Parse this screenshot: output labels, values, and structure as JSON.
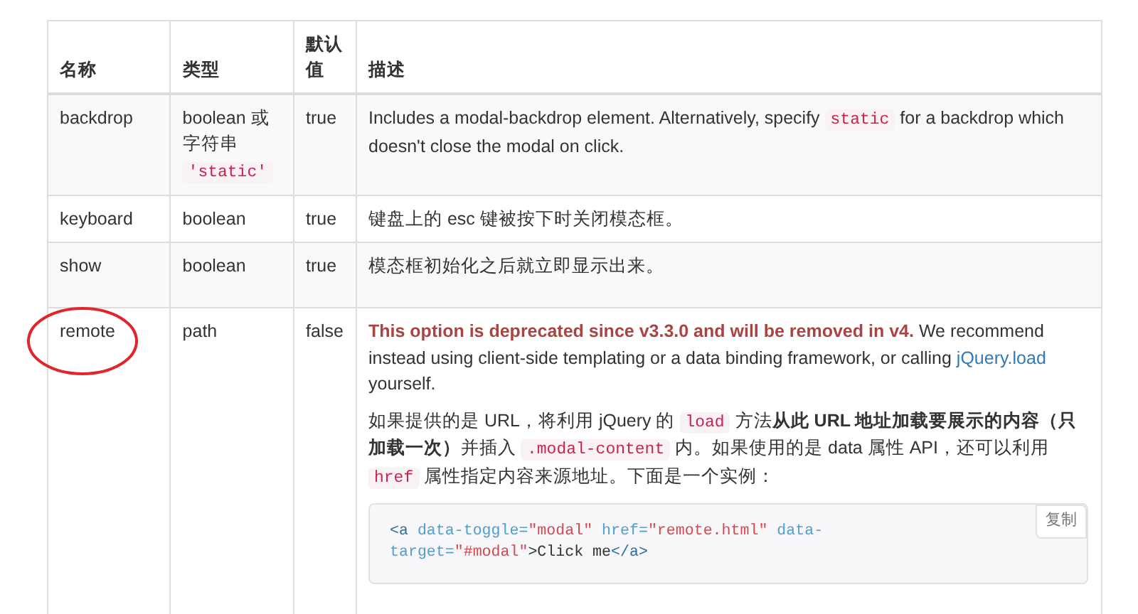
{
  "table": {
    "columns": [
      "名称",
      "类型",
      "默认值",
      "描述"
    ],
    "rows": [
      {
        "name": "backdrop",
        "circled": false,
        "type": [
          {
            "kind": "line",
            "text": "boolean 或"
          },
          {
            "kind": "line",
            "text": "字符串"
          },
          {
            "kind": "code",
            "text": "'static'"
          }
        ],
        "default": "true",
        "description": [
          [
            {
              "kind": "text",
              "text": "Includes a modal-backdrop element. Alternatively, specify "
            },
            {
              "kind": "code",
              "text": "static"
            },
            {
              "kind": "text",
              "text": " for a backdrop which doesn't close the modal on click."
            }
          ]
        ]
      },
      {
        "name": "keyboard",
        "circled": false,
        "type": [
          {
            "kind": "text",
            "text": "boolean"
          }
        ],
        "default": "true",
        "description": [
          [
            {
              "kind": "text",
              "text": "键盘上的 esc 键被按下时关闭模态框。"
            }
          ]
        ]
      },
      {
        "name": "show",
        "circled": false,
        "type": [
          {
            "kind": "text",
            "text": "boolean"
          }
        ],
        "default": "true",
        "description": [
          [
            {
              "kind": "text",
              "text": "模态框初始化之后就立即显示出来。"
            }
          ]
        ]
      },
      {
        "name": "remote",
        "circled": true,
        "type": [
          {
            "kind": "text",
            "text": "path"
          }
        ],
        "default": "false",
        "description": [
          [
            {
              "kind": "warning",
              "text": "This option is deprecated since v3.3.0 and will be removed in v4."
            },
            {
              "kind": "text",
              "text": " We recommend instead using client-side templating or a data binding framework, or calling "
            },
            {
              "kind": "link",
              "text": "jQuery.load"
            },
            {
              "kind": "text",
              "text": " yourself."
            }
          ],
          [
            {
              "kind": "text",
              "text": "如果提供的是 URL，将利用 jQuery 的 "
            },
            {
              "kind": "code",
              "text": "load"
            },
            {
              "kind": "text",
              "text": " 方法"
            },
            {
              "kind": "strong",
              "text": "从此 URL 地址加载要展示的内容（只加载一次）"
            },
            {
              "kind": "text",
              "text": "并插入 "
            },
            {
              "kind": "code",
              "text": ".modal-content"
            },
            {
              "kind": "text",
              "text": " 内。如果使用的是 data 属性 API，还可以利用 "
            },
            {
              "kind": "code",
              "text": "href"
            },
            {
              "kind": "text",
              "text": " 属性指定内容来源地址。下面是一个实例："
            }
          ]
        ],
        "code_example": {
          "copy_button": "复制",
          "tokens": [
            {
              "kind": "tag",
              "text": "<a"
            },
            {
              "kind": "attr",
              "text": " data-toggle="
            },
            {
              "kind": "value",
              "text": "\"modal\""
            },
            {
              "kind": "attr",
              "text": " href="
            },
            {
              "kind": "value",
              "text": "\"remote.html\""
            },
            {
              "kind": "attr",
              "text": " data-target="
            },
            {
              "kind": "value",
              "text": "\"#modal\""
            },
            {
              "kind": "text",
              "text": ">Click me"
            },
            {
              "kind": "tag",
              "text": "</a>"
            }
          ]
        }
      }
    ]
  }
}
